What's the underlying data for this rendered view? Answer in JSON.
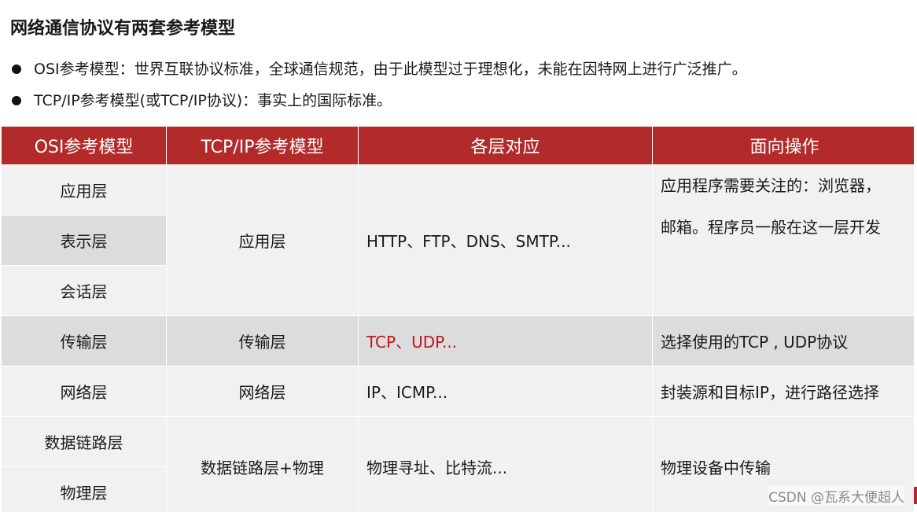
{
  "title": "网络通信协议有两套参考模型",
  "bullets": [
    "OSI参考模型：世界互联协议标准，全球通信规范，由于此模型过于理想化，未能在因特网上进行广泛推广。",
    "TCP/IP参考模型(或TCP/IP协议)：事实上的国际标准。"
  ],
  "table": {
    "headers": [
      "OSI参考模型",
      "TCP/IP参考模型",
      "各层对应",
      "面向操作"
    ],
    "osi_layers": [
      "应用层",
      "表示层",
      "会话层",
      "传输层",
      "网络层",
      "数据链路层",
      "物理层"
    ],
    "tcpip_layers": [
      "应用层",
      "传输层",
      "网络层",
      "数据链路层+物理"
    ],
    "protocols": [
      "HTTP、FTP、DNS、SMTP...",
      "TCP、UDP...",
      "IP、ICMP...",
      "物理寻址、比特流..."
    ],
    "operations": {
      "app_line1": "应用程序需要关注的：浏览器，",
      "app_line2": "邮箱。程序员一般在这一层开发",
      "transport": "选择使用的TCP , UDP协议",
      "network": "封装源和目标IP，进行路径选择",
      "physical": "物理设备中传输"
    }
  },
  "colors": {
    "header_bg": "#b32a2a",
    "highlight_text": "#c0141a"
  },
  "watermark": "CSDN @瓦系大便超人"
}
